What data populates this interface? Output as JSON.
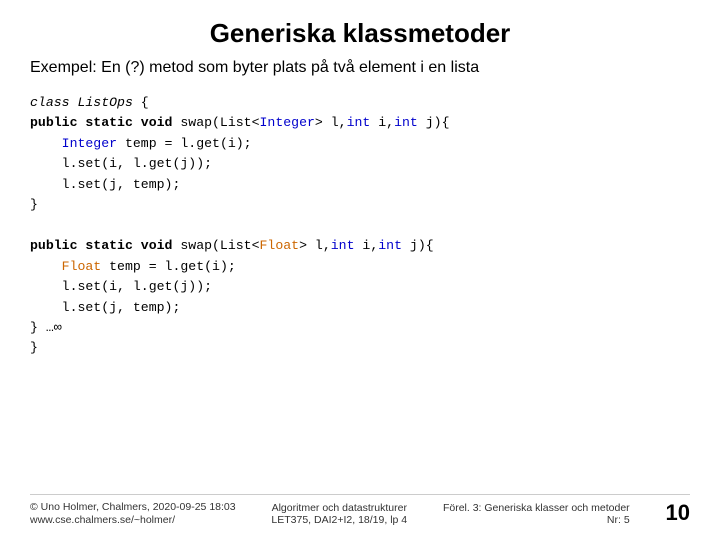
{
  "slide": {
    "title": "Generiska klassmetoder",
    "subtitle": "Exempel: En (?) metod som byter plats på två element i en lista",
    "code": {
      "class_line": "class ListOps {",
      "method1_sig": "public static void swap(List<Integer> l, int i, int j){",
      "method1_body": [
        "    Integer temp = l.get(i);",
        "    l.set(i, l.get(j));",
        "    l.set(j, temp);"
      ],
      "close1": "}",
      "method2_sig": "public static void swap(List<Float> l, int i, int j){",
      "method2_body": [
        "    Float temp = l.get(i);",
        "    l.set(i, l.get(j));",
        "    l.set(j, temp);"
      ],
      "close2": "} …∞",
      "close3": "}"
    },
    "footer": {
      "left_line1": "© Uno Holmer, Chalmers, 2020-09-25 18:03",
      "left_line2": "www.cse.chalmers.se/~holmer/",
      "center_line1": "Algoritmer och datastrukturer",
      "center_line2": "LET375, DAI2+I2, 18/19, lp 4",
      "right_line1": "Förel. 3: Generiska klasser och metoder",
      "right_line2": "Nr: 5",
      "page_number": "10"
    }
  }
}
